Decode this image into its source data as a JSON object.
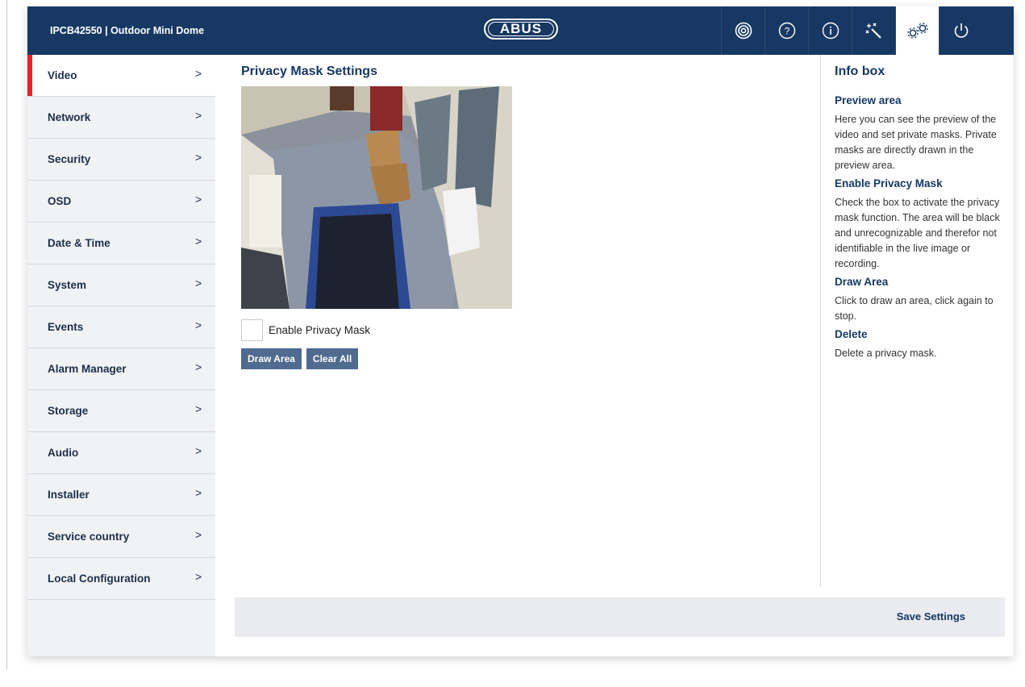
{
  "header": {
    "title": "IPCB42550  |  Outdoor Mini Dome",
    "logo_text": "ABUS",
    "icons": [
      "live-view-icon",
      "help-icon",
      "info-icon",
      "wizard-icon",
      "settings-icon",
      "power-icon"
    ],
    "active_icon": "settings-icon",
    "bg_color": "#173863"
  },
  "sidebar": {
    "items": [
      {
        "label": "Video",
        "chevron": ">"
      },
      {
        "label": "Network",
        "chevron": ">"
      },
      {
        "label": "Security",
        "chevron": ">"
      },
      {
        "label": "OSD",
        "chevron": ">"
      },
      {
        "label": "Date & Time",
        "chevron": ">"
      },
      {
        "label": "System",
        "chevron": ">"
      },
      {
        "label": "Events",
        "chevron": ">"
      },
      {
        "label": "Alarm Manager",
        "chevron": ">"
      },
      {
        "label": "Storage",
        "chevron": ">"
      },
      {
        "label": "Audio",
        "chevron": ">"
      },
      {
        "label": "Installer",
        "chevron": ">"
      },
      {
        "label": "Service country",
        "chevron": ">"
      },
      {
        "label": "Local Configuration",
        "chevron": ">"
      }
    ],
    "active_item": "Video",
    "accent_color": "#e2252b"
  },
  "main": {
    "title": "Privacy Mask Settings",
    "checkbox_label": "Enable Privacy Mask",
    "checkbox_checked": false,
    "draw_area_label": "Draw Area",
    "clear_all_label": "Clear All"
  },
  "info": {
    "title": "Info box",
    "sections": [
      {
        "heading": "Preview area",
        "text": "Here you can see the preview of the video and set private masks. Private masks are directly drawn in the preview area."
      },
      {
        "heading": "Enable Privacy Mask",
        "text": "Check the box to activate the privacy mask function. The area will be black and unrecognizable and therefor not identifiable in the live image or recording."
      },
      {
        "heading": "Draw Area",
        "text": "Click to draw an area, click again to stop."
      },
      {
        "heading": "Delete",
        "text": "Delete a privacy mask."
      }
    ]
  },
  "footer": {
    "save_label": "Save Settings"
  }
}
